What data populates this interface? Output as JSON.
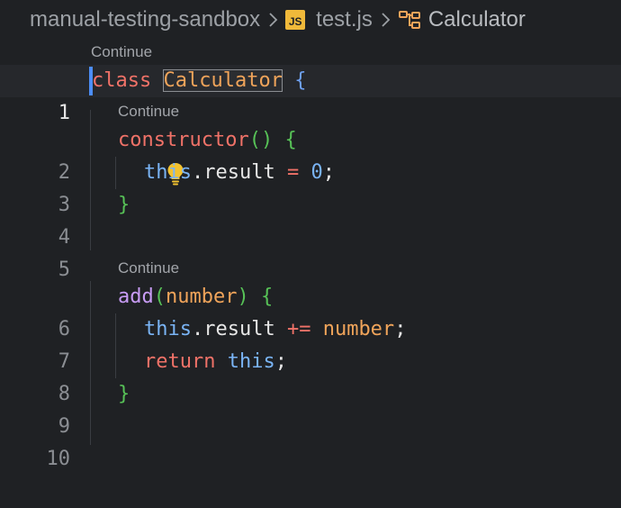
{
  "breadcrumb": {
    "folder": "manual-testing-sandbox",
    "file": "test.js",
    "file_icon": "JS",
    "symbol": "Calculator"
  },
  "codelens": {
    "label": "Continue"
  },
  "lines": {
    "n1": "1",
    "n2": "2",
    "n3": "3",
    "n4": "4",
    "n5": "5",
    "n6": "6",
    "n7": "7",
    "n8": "8",
    "n9": "9",
    "n10": "10"
  },
  "code": {
    "l1_kw": "class",
    "l1_name": "Calculator",
    "l1_brace": "{",
    "l2_fn": "constructor",
    "l2_parens": "()",
    "l2_brace": "{",
    "l3_this": "this",
    "l3_prop": ".result",
    "l3_op": "=",
    "l3_num": "0",
    "l3_semi": ";",
    "l4_brace": "}",
    "l6_fn": "add",
    "l6_open": "(",
    "l6_param": "number",
    "l6_close": ")",
    "l6_brace": "{",
    "l7_this": "this",
    "l7_prop": ".result",
    "l7_op": "+=",
    "l7_arg": "number",
    "l7_semi": ";",
    "l8_kw": "return",
    "l8_this": "this",
    "l8_semi": ";",
    "l9_brace": "}"
  },
  "colors": {
    "background": "#1f2124",
    "keyword": "#f07268",
    "class_name": "#f0a45a",
    "this": "#7ab4f5",
    "method": "#c89cf5",
    "brace": "#57c257",
    "caret": "#4c8df6"
  },
  "icons": {
    "separator": "chevron-right-icon",
    "class_symbol": "class-symbol-icon",
    "lightbulb": "lightbulb-icon"
  }
}
